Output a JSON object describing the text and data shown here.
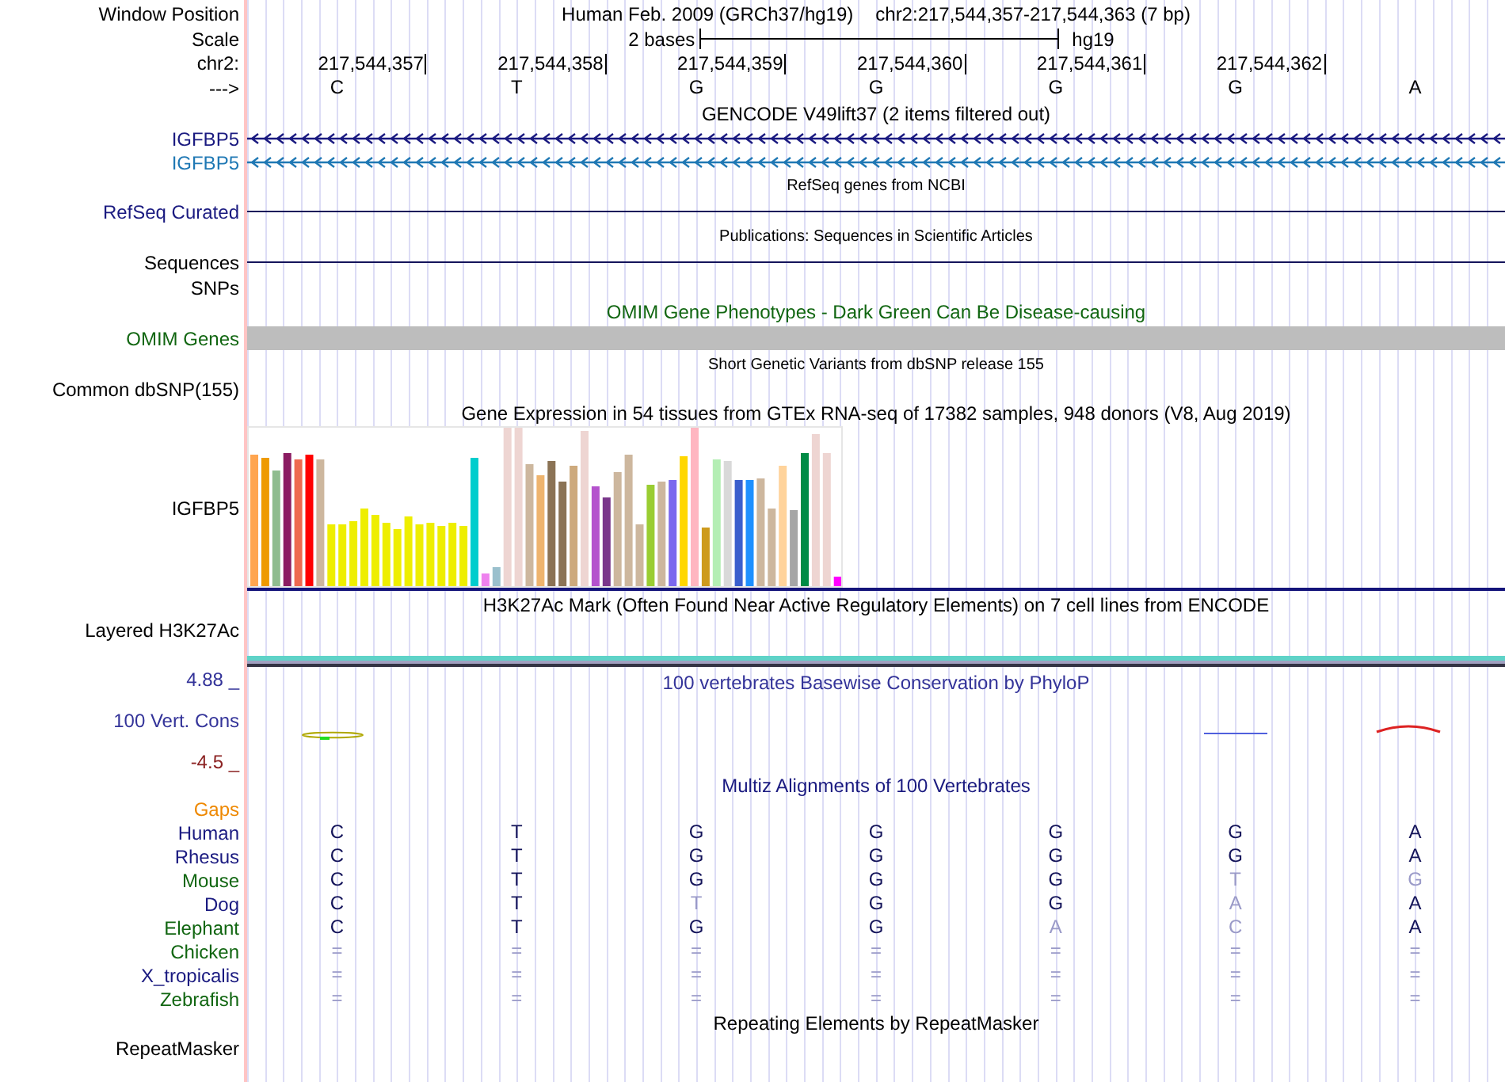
{
  "header": {
    "label": "Window Position",
    "assembly": "Human Feb. 2009 (GRCh37/hg19)",
    "position": "chr2:217,544,357-217,544,363 (7 bp)"
  },
  "scale": {
    "label": "Scale",
    "span": "2 bases",
    "assembly": "hg19"
  },
  "ruler": {
    "label": "chr2:",
    "ticks": [
      "217,544,357",
      "217,544,358",
      "217,544,359",
      "217,544,360",
      "217,544,361",
      "217,544,362"
    ]
  },
  "sequence": {
    "label": "--->",
    "bases": [
      "C",
      "T",
      "G",
      "G",
      "G",
      "G",
      "A"
    ]
  },
  "tracks": [
    {
      "kind": "genes",
      "title": "GENCODE V49lift37 (2 items filtered out)",
      "small_title": false,
      "items": [
        {
          "label": "IGFBP5",
          "color": "#1a1a80"
        },
        {
          "label": "IGFBP5",
          "color": "#1f78b4"
        }
      ]
    },
    {
      "kind": "line",
      "title": "RefSeq genes from NCBI",
      "small_title": true,
      "label": "RefSeq Curated",
      "color": "#1a1a80"
    },
    {
      "kind": "line",
      "title": "Publications: Sequences in Scientific Articles",
      "small_title": true,
      "label": "Sequences",
      "color": "#000000"
    },
    {
      "kind": "empty",
      "label": "SNPs",
      "color": "#000000"
    },
    {
      "kind": "bar",
      "title": "OMIM Gene Phenotypes - Dark Green Can Be Disease-causing",
      "small_title": false,
      "label": "OMIM Genes",
      "color": "#116611"
    },
    {
      "kind": "empty",
      "title": "Short Genetic Variants from dbSNP release 155",
      "small_title": true,
      "label": "Common dbSNP(155)",
      "color": "#000000"
    },
    {
      "kind": "expression",
      "title": "Gene Expression in 54 tissues from GTEx RNA-seq of 17382 samples, 948 donors (V8, Aug 2019)",
      "small_title": false,
      "label": "IGFBP5",
      "color": "#000000"
    },
    {
      "kind": "layered",
      "title": "H3K27Ac Mark (Often Found Near Active Regulatory Elements) on 7 cell lines from ENCODE",
      "small_title": false,
      "label": "Layered H3K27Ac",
      "color": "#000000"
    },
    {
      "kind": "conservation",
      "title": "100 vertebrates Basewise Conservation by PhyloP",
      "small_title": false,
      "label": "100 Vert. Cons",
      "color": "#333399",
      "max": "4.88 _",
      "min": "-4.5 _"
    },
    {
      "kind": "alignment",
      "title": "Multiz Alignments of 100 Vertebrates",
      "small_title": false,
      "gaps_label": "Gaps",
      "species": [
        {
          "name": "Human",
          "color": "#1a1a80",
          "bases": [
            {
              "base": "C",
              "faint": false
            },
            {
              "base": "T",
              "faint": false
            },
            {
              "base": "G",
              "faint": false
            },
            {
              "base": "G",
              "faint": false
            },
            {
              "base": "G",
              "faint": false
            },
            {
              "base": "G",
              "faint": false
            },
            {
              "base": "A",
              "faint": false
            }
          ]
        },
        {
          "name": "Rhesus",
          "color": "#1a1a80",
          "bases": [
            {
              "base": "C",
              "faint": false
            },
            {
              "base": "T",
              "faint": false
            },
            {
              "base": "G",
              "faint": false
            },
            {
              "base": "G",
              "faint": false
            },
            {
              "base": "G",
              "faint": false
            },
            {
              "base": "G",
              "faint": false
            },
            {
              "base": "A",
              "faint": false
            }
          ]
        },
        {
          "name": "Mouse",
          "color": "#116611",
          "bases": [
            {
              "base": "C",
              "faint": false
            },
            {
              "base": "T",
              "faint": false
            },
            {
              "base": "G",
              "faint": false
            },
            {
              "base": "G",
              "faint": false
            },
            {
              "base": "G",
              "faint": false
            },
            {
              "base": "T",
              "faint": true
            },
            {
              "base": "G",
              "faint": true
            }
          ]
        },
        {
          "name": "Dog",
          "color": "#1a1a80",
          "bases": [
            {
              "base": "C",
              "faint": false
            },
            {
              "base": "T",
              "faint": false
            },
            {
              "base": "T",
              "faint": true
            },
            {
              "base": "G",
              "faint": false
            },
            {
              "base": "G",
              "faint": false
            },
            {
              "base": "A",
              "faint": true
            },
            {
              "base": "A",
              "faint": false
            }
          ]
        },
        {
          "name": "Elephant",
          "color": "#116611",
          "bases": [
            {
              "base": "C",
              "faint": false
            },
            {
              "base": "T",
              "faint": false
            },
            {
              "base": "G",
              "faint": false
            },
            {
              "base": "G",
              "faint": false
            },
            {
              "base": "A",
              "faint": true
            },
            {
              "base": "C",
              "faint": true
            },
            {
              "base": "A",
              "faint": false
            }
          ]
        },
        {
          "name": "Chicken",
          "color": "#116611",
          "bases": [
            {
              "base": "=",
              "faint": true
            },
            {
              "base": "=",
              "faint": true
            },
            {
              "base": "=",
              "faint": true
            },
            {
              "base": "=",
              "faint": true
            },
            {
              "base": "=",
              "faint": true
            },
            {
              "base": "=",
              "faint": true
            },
            {
              "base": "=",
              "faint": true
            }
          ]
        },
        {
          "name": "X_tropicalis",
          "color": "#1a1a80",
          "bases": [
            {
              "base": "=",
              "faint": true
            },
            {
              "base": "=",
              "faint": true
            },
            {
              "base": "=",
              "faint": true
            },
            {
              "base": "=",
              "faint": true
            },
            {
              "base": "=",
              "faint": true
            },
            {
              "base": "=",
              "faint": true
            },
            {
              "base": "=",
              "faint": true
            }
          ]
        },
        {
          "name": "Zebrafish",
          "color": "#116611",
          "bases": [
            {
              "base": "=",
              "faint": true
            },
            {
              "base": "=",
              "faint": true
            },
            {
              "base": "=",
              "faint": true
            },
            {
              "base": "=",
              "faint": true
            },
            {
              "base": "=",
              "faint": true
            },
            {
              "base": "=",
              "faint": true
            },
            {
              "base": "=",
              "faint": true
            }
          ]
        }
      ]
    },
    {
      "kind": "empty",
      "title": "Repeating Elements by RepeatMasker",
      "small_title": false,
      "label": "RepeatMasker",
      "color": "#000000"
    }
  ]
}
